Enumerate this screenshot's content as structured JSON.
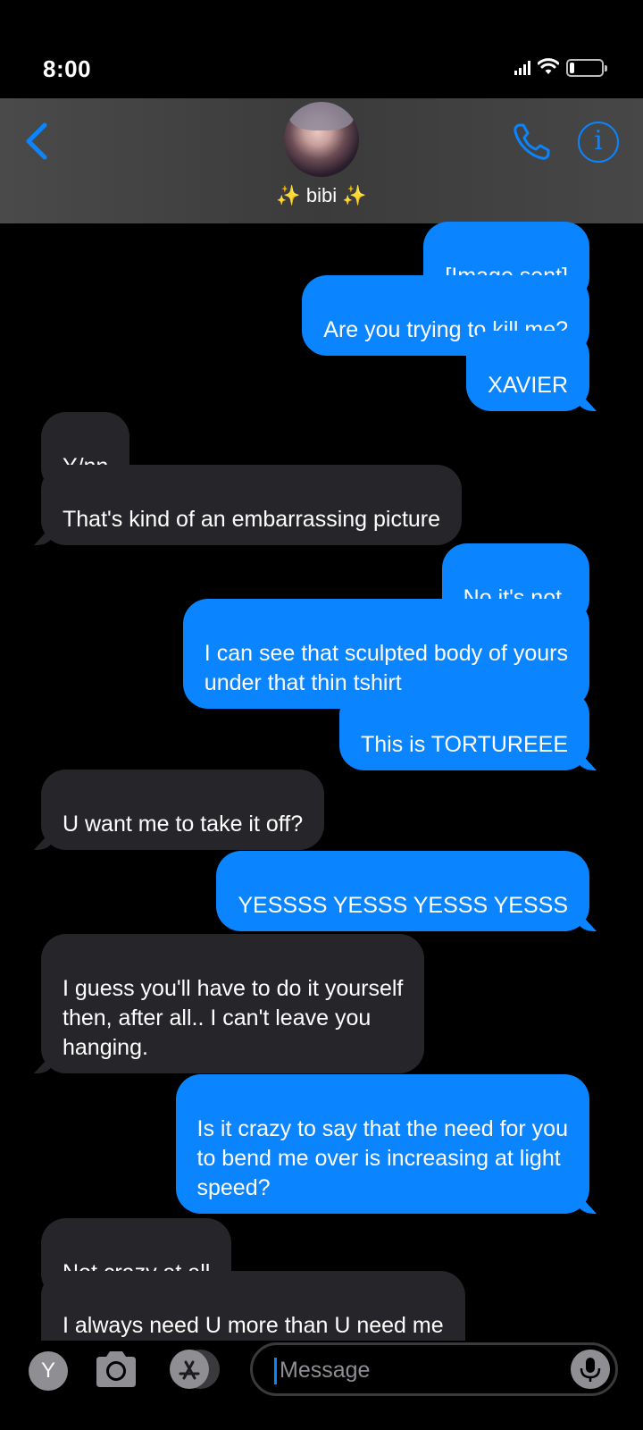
{
  "status_bar": {
    "time": "8:00",
    "icons": [
      "signal-icon",
      "wifi-icon",
      "battery-icon"
    ],
    "battery_level": 0.15
  },
  "header": {
    "contact_name": "✨ bibi ✨",
    "back_icon": "chevron-left-icon",
    "call_icon": "phone-icon",
    "info_icon": "info-icon",
    "info_glyph": "i",
    "accent_color": "#0a84ff"
  },
  "messages": [
    {
      "from": "me",
      "text": "[Image sent]"
    },
    {
      "from": "me",
      "text": "Are you trying to kill me?"
    },
    {
      "from": "me",
      "text": "XAVIER"
    },
    {
      "from": "them",
      "text": "Y/nn"
    },
    {
      "from": "them",
      "text": "That's kind of an embarrassing picture"
    },
    {
      "from": "me",
      "text": "No it's not."
    },
    {
      "from": "me",
      "text": "I can see that sculpted body of yours\nunder that thin tshirt"
    },
    {
      "from": "me",
      "text": "This is TORTUREEE"
    },
    {
      "from": "them",
      "text": "U want me to take it off?"
    },
    {
      "from": "me",
      "text": "YESSSS YESSS YESSS YESSS"
    },
    {
      "from": "them",
      "text": "I guess you'll have to do it yourself\nthen, after all.. I can't leave you\nhanging."
    },
    {
      "from": "me",
      "text": "Is it crazy to say that the need for you\nto bend me over is increasing at light\nspeed?"
    },
    {
      "from": "them",
      "text": "Not crazy at all"
    },
    {
      "from": "them",
      "text": "I always need U more than U need me\nanyways"
    }
  ],
  "input_bar": {
    "app_initial": "Y",
    "camera_icon": "camera-icon",
    "appstore_icon": "app-store-icon",
    "placeholder": "Message",
    "mic_icon": "microphone-icon"
  },
  "colors": {
    "sent_bubble": "#0b84ff",
    "received_bubble": "#262529",
    "background": "#000000"
  }
}
